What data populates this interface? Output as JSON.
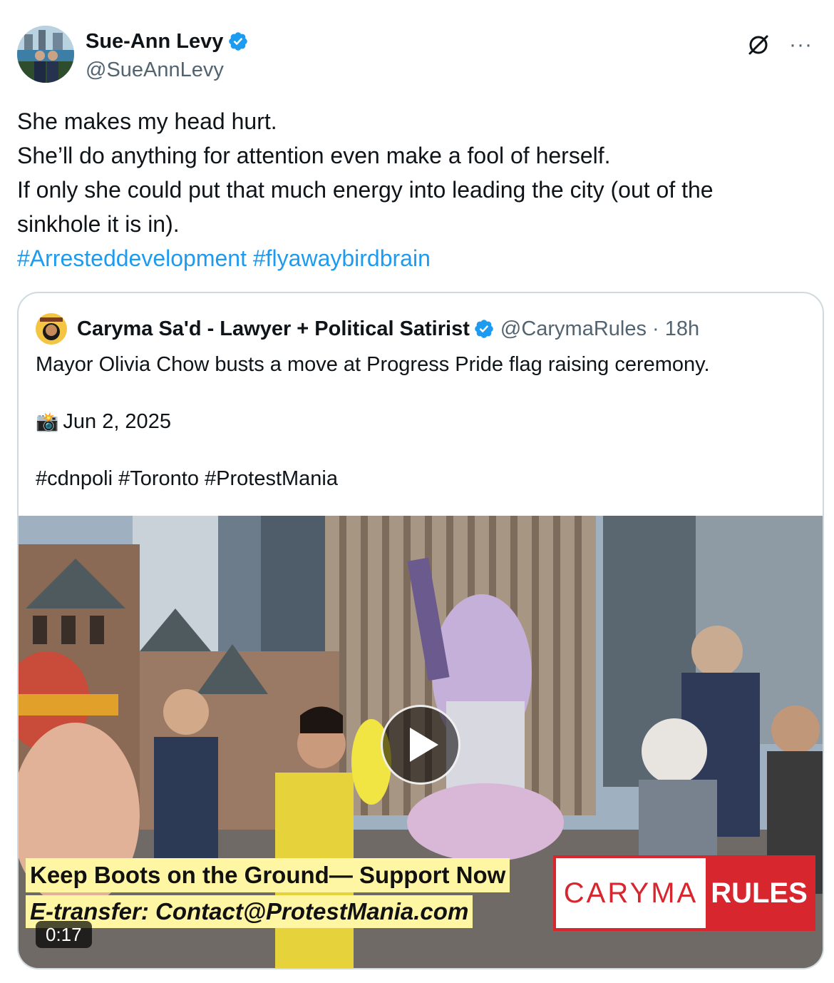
{
  "author": {
    "display_name": "Sue-Ann Levy",
    "handle": "@SueAnnLevy",
    "verified_color": "#1d9bf0"
  },
  "header_icons": {
    "grok": "grok-icon",
    "more": "···"
  },
  "tweet": {
    "lines": [
      "She makes my head hurt.",
      "She’ll do anything for attention even make a fool of herself.",
      "If only she could put that much energy into leading the city (out of the",
      "sinkhole it is in)."
    ],
    "hashtags": [
      "#Arresteddevelopment",
      "#flyawaybirdbrain"
    ]
  },
  "quote": {
    "display_name": "Caryma Sa'd - Lawyer + Political Satirist",
    "handle": "@CarymaRules",
    "separator": "·",
    "time": "18h",
    "text": "Mayor Olivia Chow busts a move at Progress Pride flag raising ceremony.",
    "camera_icon": "📸",
    "date": "Jun 2, 2025",
    "hashtags": "#cdnpoli #Toronto #ProtestMania",
    "video": {
      "banner_line1": "Keep Boots on the Ground— Support Now",
      "banner_line2": "E-transfer: Contact@ProtestMania.com",
      "brand_left": "CARYMA",
      "brand_right": "RULES",
      "duration": "0:17"
    }
  },
  "colors": {
    "link": "#1d9bf0",
    "secondary_text": "#536471",
    "border": "#cfd9de",
    "brand_red": "#d7262e",
    "banner_yellow": "#fff6a3"
  }
}
